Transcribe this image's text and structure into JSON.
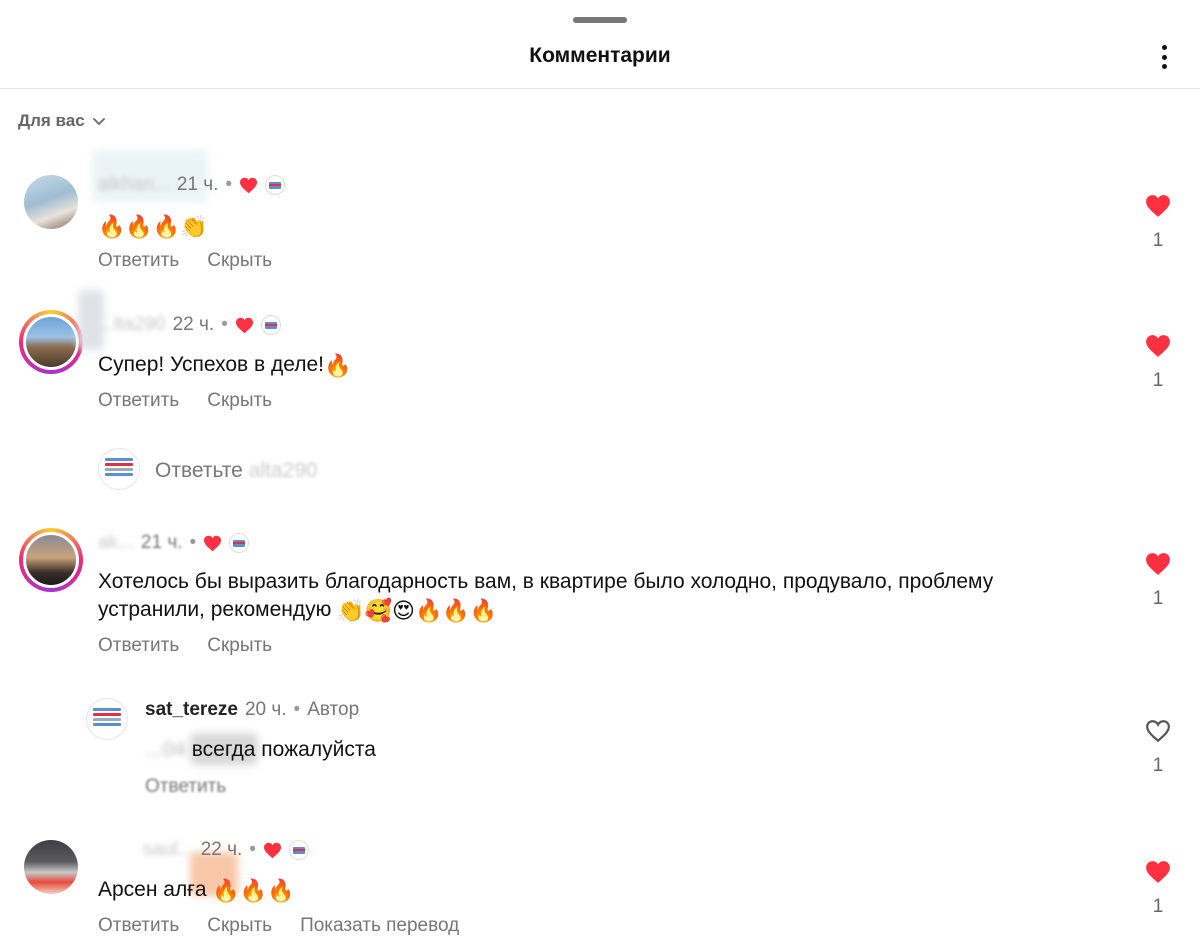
{
  "header": {
    "title": "Комментарии"
  },
  "sort": {
    "label": "Для вас"
  },
  "comments": [
    {
      "username": "alkhan...",
      "time": "21 ч.",
      "text": "",
      "emoji": "🔥🔥🔥👏",
      "reply": "Ответить",
      "hide": "Скрыть",
      "likes": "1"
    },
    {
      "username": "...lta290",
      "time": "22 ч.",
      "text": "Супер! Успехов в деле!",
      "emoji": "🔥",
      "reply": "Ответить",
      "hide": "Скрыть",
      "likes": "1"
    },
    {
      "username": "ak...",
      "time": "21 ч.",
      "text_line1": "Хотелось бы выразить благодарность вам, в квартире было холодно, продувало, проблему",
      "text_line2": "устранили, рекомендую",
      "emoji": "👏🥰😍🔥🔥🔥",
      "reply": "Ответить",
      "hide": "Скрыть",
      "likes": "1"
    },
    {
      "username": "saul...",
      "time": "22 ч.",
      "text": "Арсен алға",
      "emoji": "🔥🔥🔥",
      "reply": "Ответить",
      "hide": "Скрыть",
      "translate": "Показать перевод",
      "likes": "1"
    }
  ],
  "reply_prompt": {
    "prefix": "Ответьте",
    "target": "alta290"
  },
  "author_reply": {
    "username": "sat_tereze",
    "time": "20 ч.",
    "badge": "Автор",
    "mention": "...04",
    "text": "всегда пожалуйста",
    "reply": "Ответить",
    "likes": "1"
  },
  "colors": {
    "like_red": "#ff3040",
    "muted": "#777777",
    "divider": "#e4e4e4"
  },
  "icons": [
    "kebab-menu-icon",
    "chevron-down-icon",
    "heart-filled-icon",
    "heart-outline-icon"
  ]
}
